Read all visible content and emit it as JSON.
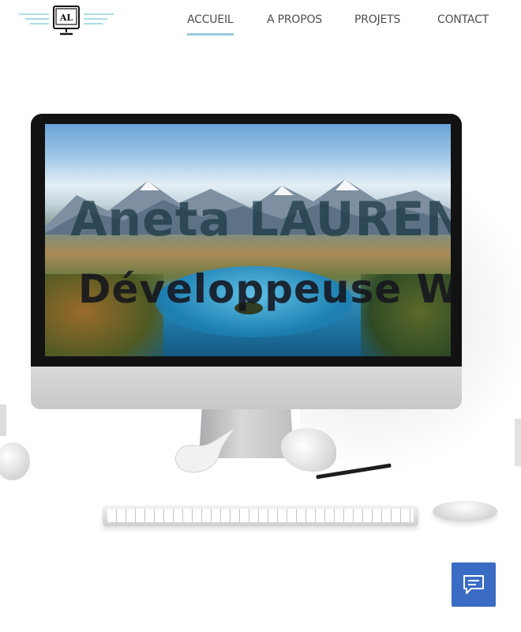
{
  "logo": {
    "text": "AL",
    "icon": "monitor-logo-icon"
  },
  "nav": {
    "items": [
      {
        "label": "ACCUEIL",
        "active": true
      },
      {
        "label": "A PROPOS",
        "active": false
      },
      {
        "label": "PROJETS",
        "active": false
      },
      {
        "label": "CONTACT",
        "active": false
      }
    ]
  },
  "hero": {
    "name": "Aneta LAURENT",
    "role": "Développeuse Web"
  },
  "chat": {
    "icon": "chat-bubble-icon"
  },
  "colors": {
    "nav_active_underline": "#9ccbd8",
    "nav_text": "#4a4f56",
    "chat_button": "#3a6cc4",
    "logo_lines": "#8fd0dc"
  }
}
